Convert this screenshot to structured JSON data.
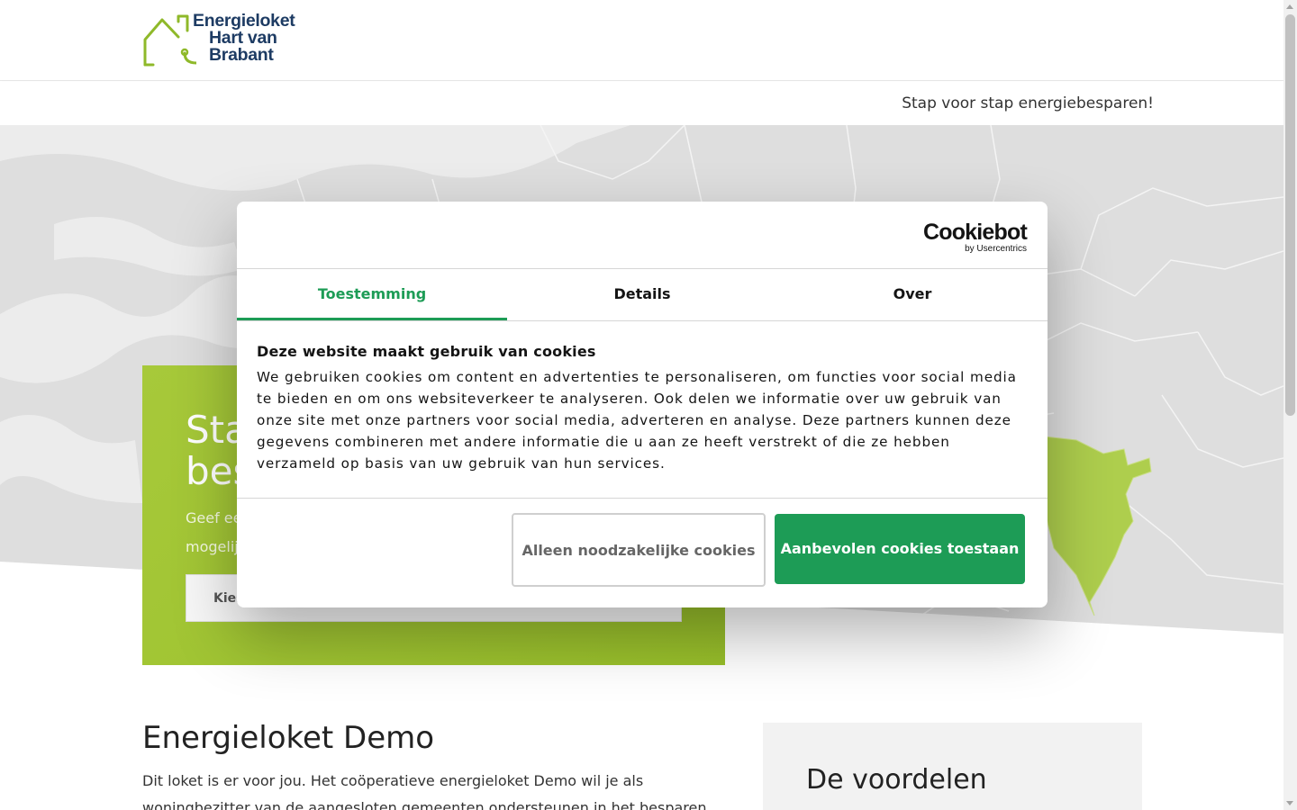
{
  "header": {
    "logo_lines": [
      "Energieloket",
      "Hart van",
      "Brabant"
    ],
    "tagline": "Stap voor stap energiebesparen!"
  },
  "hero": {
    "title_partial": "Sta\nbes",
    "subtitle_partial": "Geef een\nmogelijk",
    "select_partial": "Kies"
  },
  "content": {
    "title": "Energieloket Demo",
    "text": "Dit loket is er voor jou. Het coöperatieve energieloket Demo wil je als woningbezitter van de aangesloten gemeenten ondersteunen in het besparen van energie. Wij geven je niet",
    "side_title": "De voordelen"
  },
  "cookie_dialog": {
    "brand": "Cookiebot",
    "brand_by": "by Usercentrics",
    "tabs": [
      {
        "label": "Toestemming",
        "active": true
      },
      {
        "label": "Details",
        "active": false
      },
      {
        "label": "Over",
        "active": false
      }
    ],
    "heading": "Deze website maakt gebruik van cookies",
    "text": "We gebruiken cookies om content en advertenties te personaliseren, om functies voor social media te bieden en om ons websiteverkeer te analyseren. Ook delen we informatie over uw gebruik van onze site met onze partners voor social media, adverteren en analyse. Deze partners kunnen deze gegevens combineren met andere informatie die u aan ze heeft verstrekt of die ze hebben verzameld op basis van uw gebruik van hun services.",
    "btn_necessary": "Alleen noodzakelijke cookies",
    "btn_allow": "Aanbevolen cookies toestaan"
  },
  "colors": {
    "accent_green": "#1d9c56",
    "brand_lime": "#a7c93a",
    "brand_navy": "#1d3b63"
  }
}
